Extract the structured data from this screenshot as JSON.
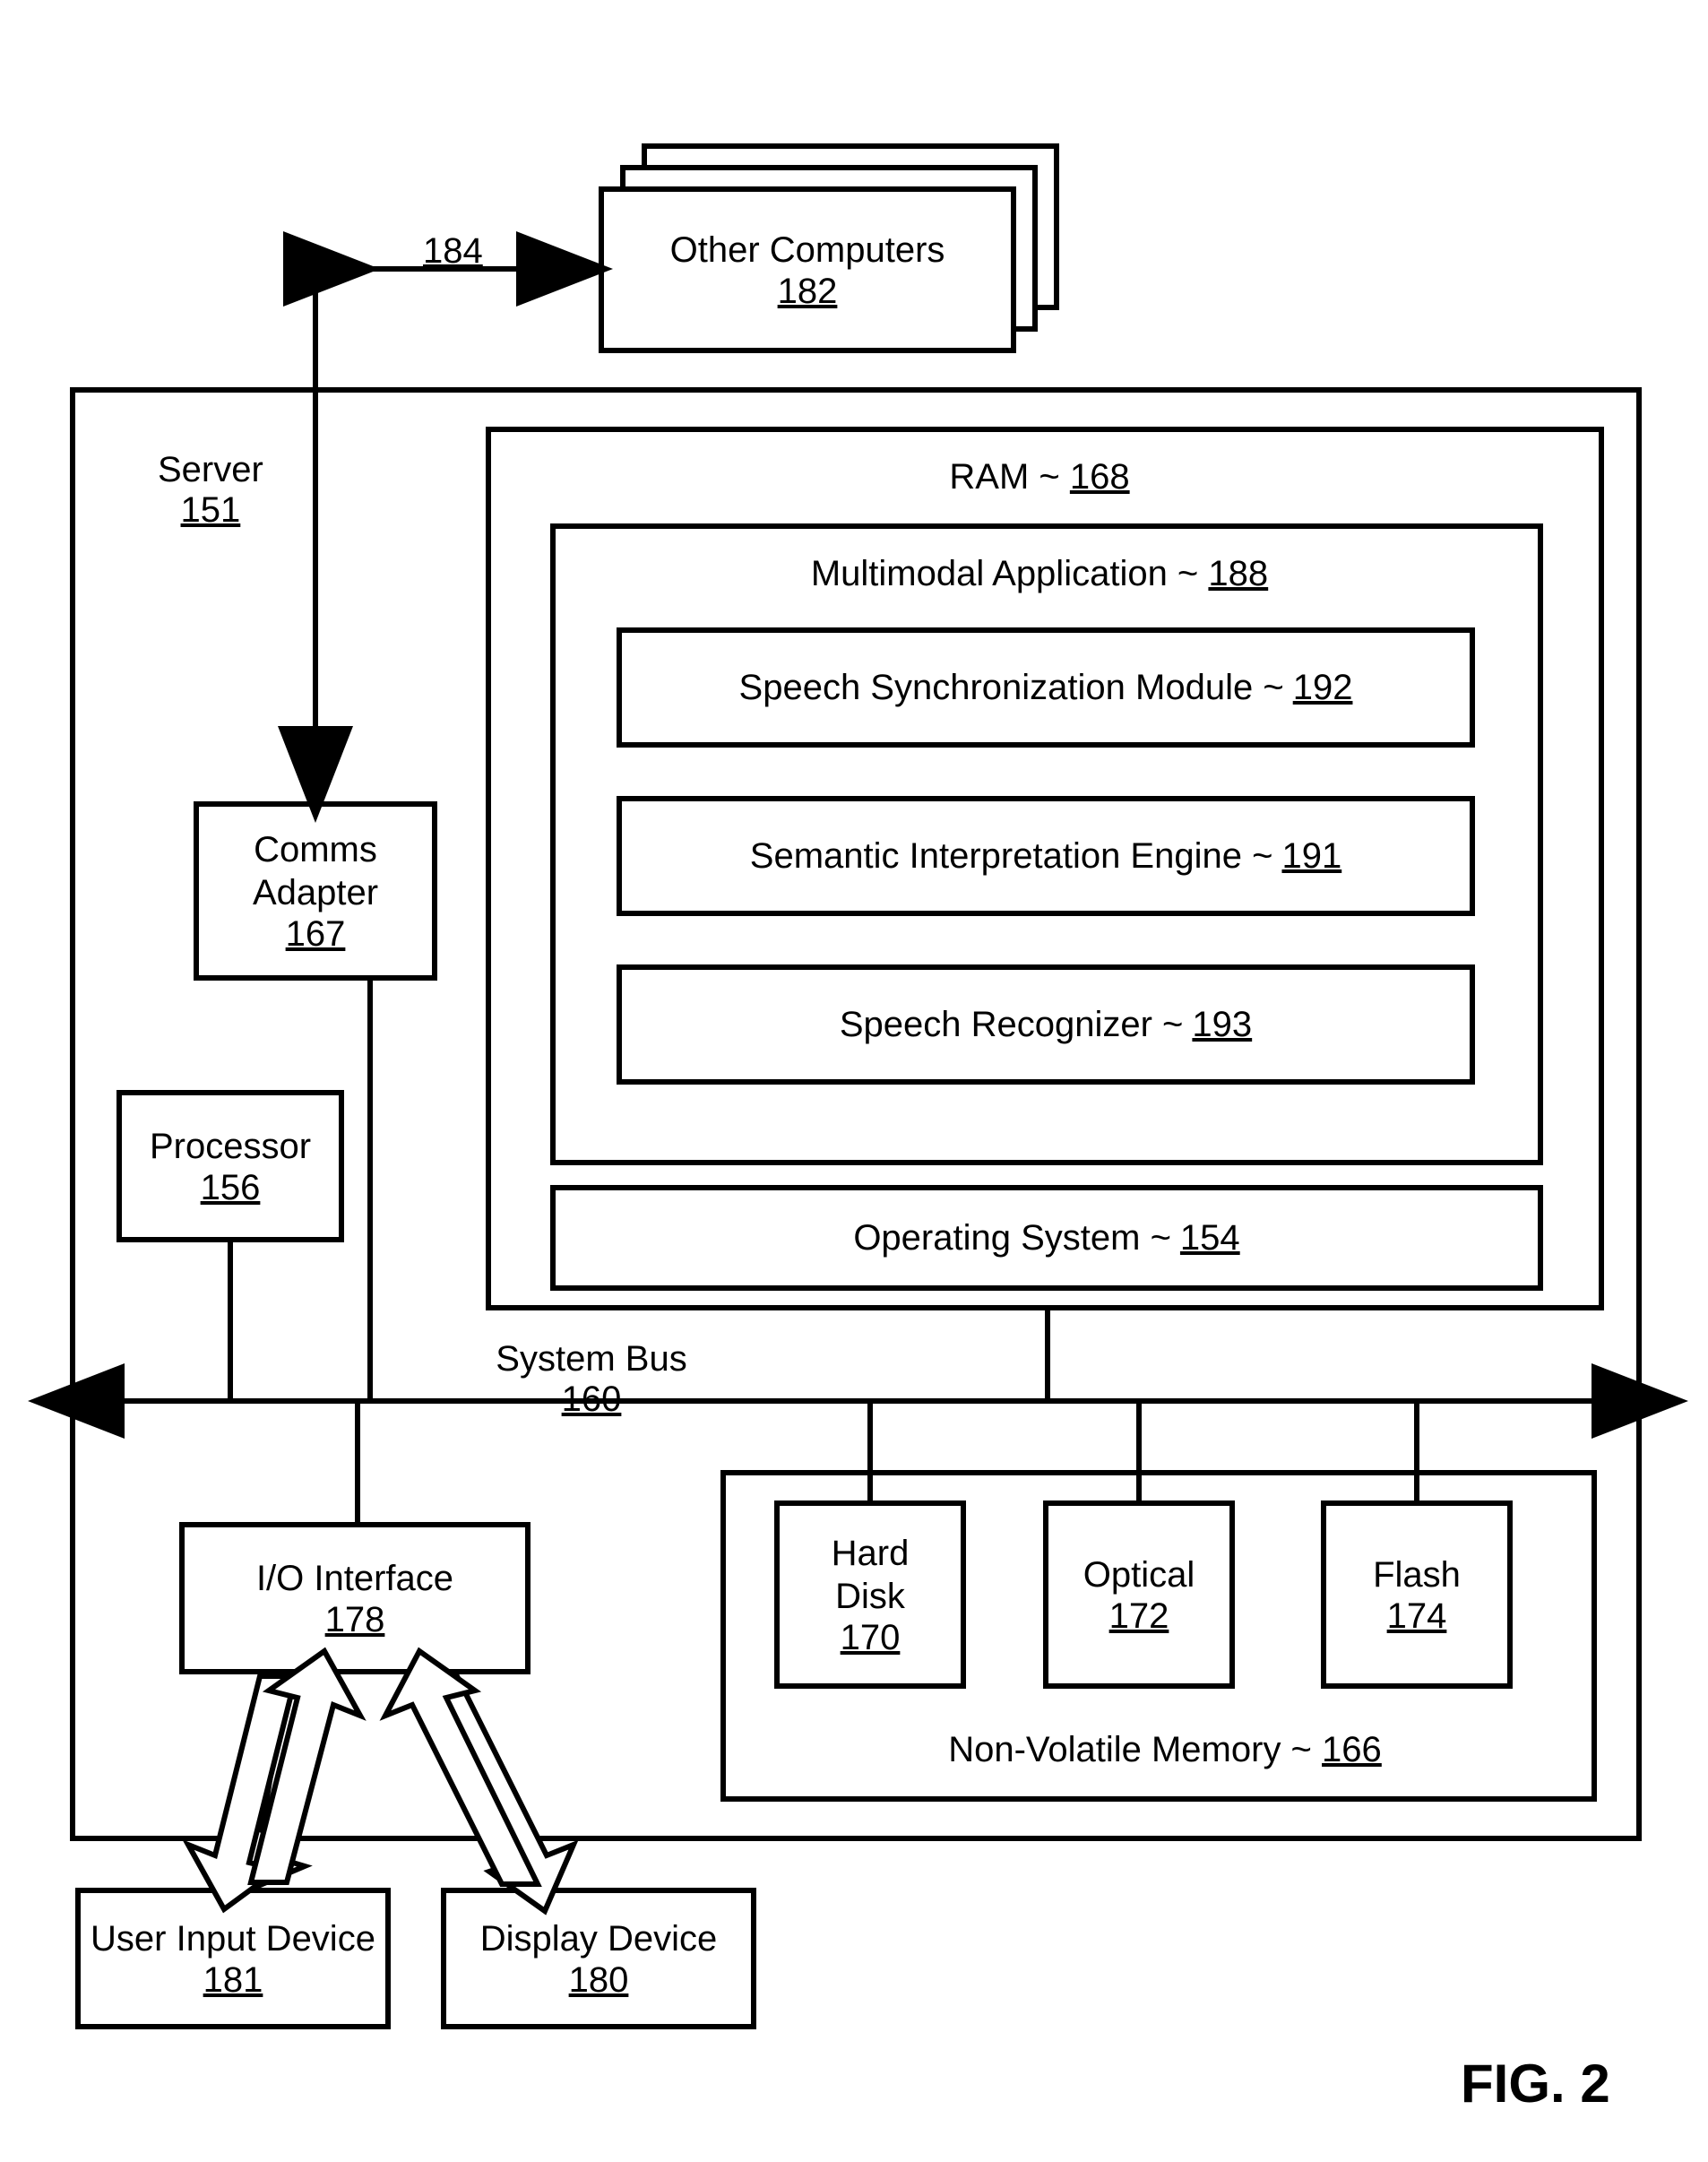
{
  "figure_label": "FIG. 2",
  "other_computers": {
    "label": "Other Computers",
    "ref": "182"
  },
  "link_ref": "184",
  "server": {
    "label": "Server",
    "ref": "151"
  },
  "comms_adapter": {
    "label": "Comms Adapter",
    "ref": "167"
  },
  "processor": {
    "label": "Processor",
    "ref": "156"
  },
  "ram": {
    "label": "RAM ~",
    "ref": "168"
  },
  "multimodal_app": {
    "label": "Multimodal Application ~",
    "ref": "188"
  },
  "speech_sync": {
    "label": "Speech Synchronization Module ~",
    "ref": "192"
  },
  "semantic_engine": {
    "label": "Semantic Interpretation Engine ~",
    "ref": "191"
  },
  "speech_recognizer": {
    "label": "Speech Recognizer ~",
    "ref": "193"
  },
  "operating_system": {
    "label": "Operating System ~",
    "ref": "154"
  },
  "system_bus": {
    "label": "System Bus",
    "ref": "160"
  },
  "io_interface": {
    "label": "I/O Interface",
    "ref": "178"
  },
  "nonvolatile": {
    "label": "Non-Volatile Memory ~",
    "ref": "166"
  },
  "hard_disk": {
    "label": "Hard Disk",
    "ref": "170"
  },
  "optical": {
    "label": "Optical",
    "ref": "172"
  },
  "flash": {
    "label": "Flash",
    "ref": "174"
  },
  "user_input": {
    "label": "User Input Device",
    "ref": "181"
  },
  "display": {
    "label": "Display Device",
    "ref": "180"
  }
}
